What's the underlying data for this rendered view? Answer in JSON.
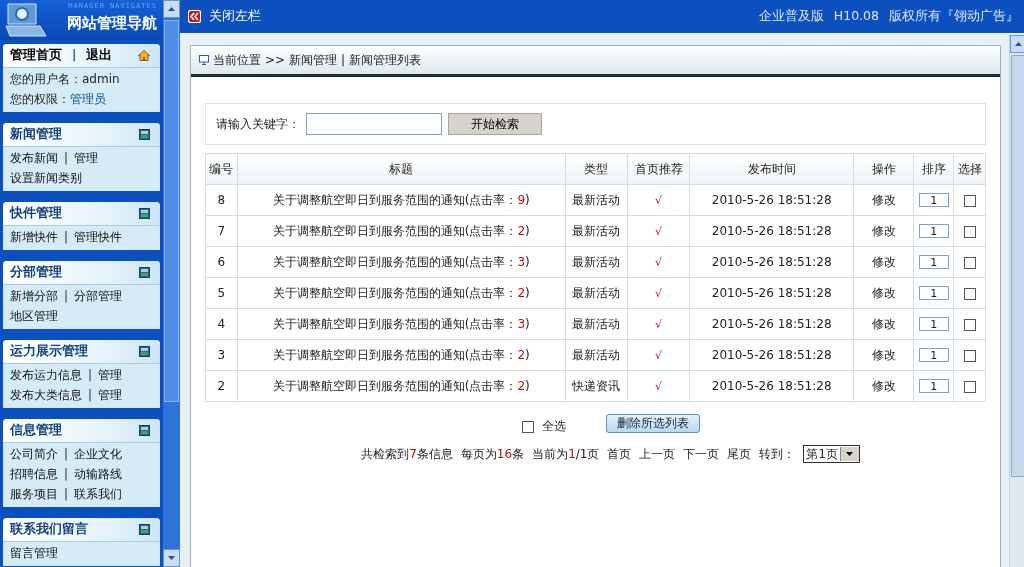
{
  "sidebar": {
    "logo_caption": "MANAGER NAVIGATES",
    "logo_title": "网站管理导航",
    "top": {
      "links": [
        "管理首页",
        "退出"
      ],
      "user": [
        {
          "label": "您的用户名：",
          "value": "admin",
          "link": false
        },
        {
          "label": "您的权限：",
          "value": "管理员",
          "link": true
        }
      ]
    },
    "link_separator": "|",
    "sections": [
      {
        "title": "新闻管理",
        "lines": [
          [
            "发布新闻",
            "管理"
          ],
          [
            "设置新闻类别"
          ]
        ]
      },
      {
        "title": "快件管理",
        "lines": [
          [
            "新增快件",
            "管理快件"
          ]
        ]
      },
      {
        "title": "分部管理",
        "lines": [
          [
            "新增分部",
            "分部管理"
          ],
          [
            "地区管理"
          ]
        ]
      },
      {
        "title": "运力展示管理",
        "lines": [
          [
            "发布运力信息",
            "管理"
          ],
          [
            "发布大类信息",
            "管理"
          ]
        ]
      },
      {
        "title": "信息管理",
        "lines": [
          [
            "公司简介",
            "企业文化"
          ],
          [
            "招聘信息",
            "动输路线"
          ],
          [
            "服务项目",
            "联系我们"
          ]
        ]
      },
      {
        "title": "联系我们留言",
        "lines": [
          [
            "留言管理"
          ]
        ]
      }
    ]
  },
  "topbar": {
    "toggle": "关闭左栏",
    "edition": "企业普及版",
    "version": "H10.08",
    "copyright": "版权所有『翎动广告』"
  },
  "breadcrumb": [
    "当前位置",
    ">>",
    "新闻管理",
    "|",
    "新闻管理列表"
  ],
  "search": {
    "label": "请输入关键字：",
    "button": "开始检索"
  },
  "table": {
    "columns": [
      "编号",
      "标题",
      "类型",
      "首页推荐",
      "发布时间",
      "操作",
      "排序",
      "选择"
    ],
    "rows": [
      {
        "id": "8",
        "title": "关于调整航空即日到服务范围的通知(点击率：",
        "clicks": "9",
        "title_end": ")",
        "type": "最新活动",
        "recommend": "√",
        "time": "2010-5-26 18:51:28",
        "action": "修改",
        "order": "1",
        "selected": false
      },
      {
        "id": "7",
        "title": "关于调整航空即日到服务范围的通知(点击率：",
        "clicks": "2",
        "title_end": ")",
        "type": "最新活动",
        "recommend": "√",
        "time": "2010-5-26 18:51:28",
        "action": "修改",
        "order": "1",
        "selected": false
      },
      {
        "id": "6",
        "title": "关于调整航空即日到服务范围的通知(点击率：",
        "clicks": "3",
        "title_end": ")",
        "type": "最新活动",
        "recommend": "√",
        "time": "2010-5-26 18:51:28",
        "action": "修改",
        "order": "1",
        "selected": false
      },
      {
        "id": "5",
        "title": "关于调整航空即日到服务范围的通知(点击率：",
        "clicks": "2",
        "title_end": ")",
        "type": "最新活动",
        "recommend": "√",
        "time": "2010-5-26 18:51:28",
        "action": "修改",
        "order": "1",
        "selected": false
      },
      {
        "id": "4",
        "title": "关于调整航空即日到服务范围的通知(点击率：",
        "clicks": "3",
        "title_end": ")",
        "type": "最新活动",
        "recommend": "√",
        "time": "2010-5-26 18:51:28",
        "action": "修改",
        "order": "1",
        "selected": false
      },
      {
        "id": "3",
        "title": "关于调整航空即日到服务范围的通知(点击率：",
        "clicks": "2",
        "title_end": ")",
        "type": "最新活动",
        "recommend": "√",
        "time": "2010-5-26 18:51:28",
        "action": "修改",
        "order": "1",
        "selected": false
      },
      {
        "id": "2",
        "title": "关于调整航空即日到服务范围的通知(点击率：",
        "clicks": "2",
        "title_end": ")",
        "type": "快递资讯",
        "recommend": "√",
        "time": "2010-5-26 18:51:28",
        "action": "修改",
        "order": "1",
        "selected": false
      }
    ]
  },
  "select_all": {
    "label": "全选",
    "checked": false
  },
  "delete_button": "删除所选列表",
  "pager": {
    "summary": [
      {
        "text": "共检索到",
        "hl": false
      },
      {
        "text": "7",
        "hl": true
      },
      {
        "text": "条信息",
        "hl": false
      }
    ],
    "per_page": [
      {
        "text": "每页为",
        "hl": false
      },
      {
        "text": "16",
        "hl": true
      },
      {
        "text": "条",
        "hl": false
      }
    ],
    "current": [
      {
        "text": "当前为",
        "hl": false
      },
      {
        "text": "1",
        "hl": true
      },
      {
        "text": "/1页",
        "hl": false
      }
    ],
    "links": [
      "首页",
      "上一页",
      "下一页",
      "尾页"
    ],
    "goto": "转到：",
    "page_select": "第1页"
  }
}
